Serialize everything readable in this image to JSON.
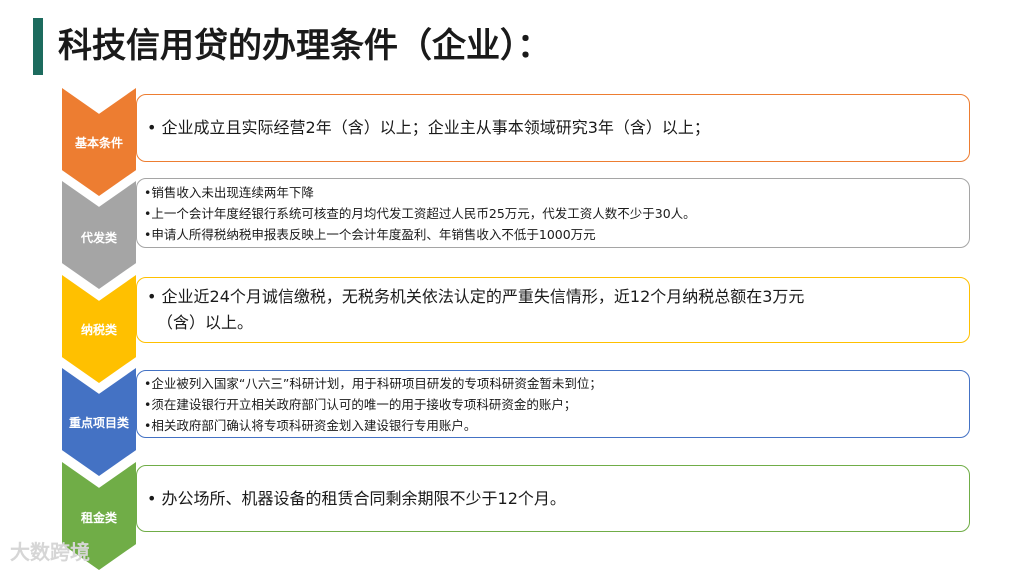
{
  "title": "科技信用贷的办理条件（企业）：",
  "colors": {
    "title_bar": "#1d6b5e",
    "orange": "#ed7d31",
    "gray": "#a5a5a5",
    "yellow": "#ffc000",
    "blue": "#4472c4",
    "green": "#70ad47"
  },
  "rows": [
    {
      "label": "基本条件",
      "lines": [
        "• 企业成立且实际经营2年（含）以上；企业主从事本领域研究3年（含）以上；"
      ]
    },
    {
      "label": "代发类",
      "lines": [
        "•销售收入未出现连续两年下降",
        "•上一个会计年度经银行系统可核查的月均代发工资超过人民币25万元，代发工资人数不少于30人。",
        "•申请人所得税纳税申报表反映上一个会计年度盈利、年销售收入不低于1000万元"
      ]
    },
    {
      "label": "纳税类",
      "lines": [
        "• 企业近24个月诚信缴税，无税务机关依法认定的严重失信情形，近12个月纳税总额在3万元",
        "（含）以上。"
      ]
    },
    {
      "label": "重点项目类",
      "lines": [
        "•企业被列入国家“八六三”科研计划，用于科研项目研发的专项科研资金暂未到位；",
        "•须在建设银行开立相关政府部门认可的唯一的用于接收专项科研资金的账户；",
        "•相关政府部门确认将专项科研资金划入建设银行专用账户。"
      ]
    },
    {
      "label": "租金类",
      "lines": [
        "• 办公场所、机器设备的租赁合同剩余期限不少于12个月。"
      ]
    }
  ],
  "watermark": "大数跨境"
}
